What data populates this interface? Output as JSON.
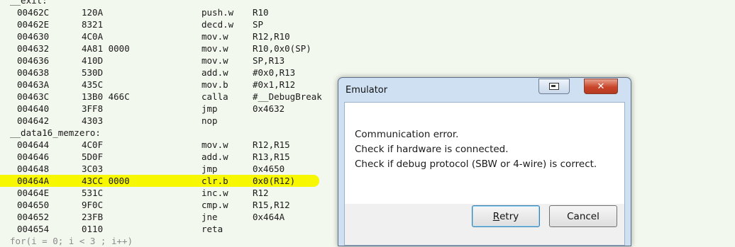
{
  "disassembly": {
    "lines": [
      {
        "kind": "label",
        "text": "__exit:"
      },
      {
        "kind": "instr",
        "addr": "00462C",
        "bytes": "120A",
        "mnem": "push.w",
        "ops": "R10",
        "highlight": false
      },
      {
        "kind": "instr",
        "addr": "00462E",
        "bytes": "8321",
        "mnem": "decd.w",
        "ops": "SP",
        "highlight": false
      },
      {
        "kind": "instr",
        "addr": "004630",
        "bytes": "4C0A",
        "mnem": "mov.w",
        "ops": "R12,R10",
        "highlight": false
      },
      {
        "kind": "instr",
        "addr": "004632",
        "bytes": "4A81 0000",
        "mnem": "mov.w",
        "ops": "R10,0x0(SP)",
        "highlight": false
      },
      {
        "kind": "instr",
        "addr": "004636",
        "bytes": "410D",
        "mnem": "mov.w",
        "ops": "SP,R13",
        "highlight": false
      },
      {
        "kind": "instr",
        "addr": "004638",
        "bytes": "530D",
        "mnem": "add.w",
        "ops": "#0x0,R13",
        "highlight": false
      },
      {
        "kind": "instr",
        "addr": "00463A",
        "bytes": "435C",
        "mnem": "mov.b",
        "ops": "#0x1,R12",
        "highlight": false
      },
      {
        "kind": "instr",
        "addr": "00463C",
        "bytes": "13B0 466C",
        "mnem": "calla",
        "ops": "#__DebugBreak",
        "highlight": false
      },
      {
        "kind": "instr",
        "addr": "004640",
        "bytes": "3FF8",
        "mnem": "jmp",
        "ops": "0x4632",
        "highlight": false
      },
      {
        "kind": "instr",
        "addr": "004642",
        "bytes": "4303",
        "mnem": "nop",
        "ops": "",
        "highlight": false
      },
      {
        "kind": "label",
        "text": "__data16_memzero:"
      },
      {
        "kind": "instr",
        "addr": "004644",
        "bytes": "4C0F",
        "mnem": "mov.w",
        "ops": "R12,R15",
        "highlight": false
      },
      {
        "kind": "instr",
        "addr": "004646",
        "bytes": "5D0F",
        "mnem": "add.w",
        "ops": "R13,R15",
        "highlight": false
      },
      {
        "kind": "instr",
        "addr": "004648",
        "bytes": "3C03",
        "mnem": "jmp",
        "ops": "0x4650",
        "highlight": false
      },
      {
        "kind": "instr",
        "addr": "00464A",
        "bytes": "43CC 0000",
        "mnem": "clr.b",
        "ops": "0x0(R12)",
        "highlight": true
      },
      {
        "kind": "instr",
        "addr": "00464E",
        "bytes": "531C",
        "mnem": "inc.w",
        "ops": "R12",
        "highlight": false
      },
      {
        "kind": "instr",
        "addr": "004650",
        "bytes": "9F0C",
        "mnem": "cmp.w",
        "ops": "R15,R12",
        "highlight": false
      },
      {
        "kind": "instr",
        "addr": "004652",
        "bytes": "23FB",
        "mnem": "jne",
        "ops": "0x464A",
        "highlight": false
      },
      {
        "kind": "instr",
        "addr": "004654",
        "bytes": "0110",
        "mnem": "reta",
        "ops": "",
        "highlight": false
      },
      {
        "kind": "source",
        "text": "for(i = 0; i < 3 ; i++)"
      }
    ]
  },
  "dialog": {
    "title": "Emulator",
    "close_glyph": "✕",
    "messages": [
      "Communication error.",
      "Check if hardware is connected.",
      "Check if debug protocol (SBW or 4-wire) is correct."
    ],
    "retry": {
      "mnemonic": "R",
      "rest": "etry"
    },
    "cancel_label": "Cancel"
  },
  "colors": {
    "background": "#f3f8ee",
    "highlight": "#f7f700",
    "dialog_frame": "#cfe0f2",
    "close_button": "#c9452b"
  }
}
